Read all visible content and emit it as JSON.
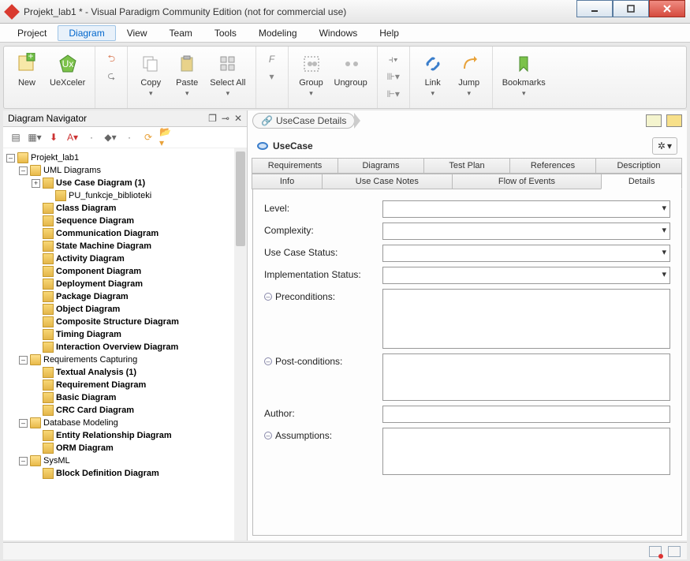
{
  "window": {
    "title": "Projekt_lab1 * - Visual Paradigm Community Edition (not for commercial use)"
  },
  "menu": {
    "items": [
      "Project",
      "Diagram",
      "View",
      "Team",
      "Tools",
      "Modeling",
      "Windows",
      "Help"
    ],
    "active": "Diagram"
  },
  "ribbon": {
    "new": "New",
    "uexceler": "UeXceler",
    "copy": "Copy",
    "paste": "Paste",
    "selectall": "Select All",
    "group": "Group",
    "ungroup": "Ungroup",
    "link": "Link",
    "jump": "Jump",
    "bookmarks": "Bookmarks"
  },
  "navigator": {
    "title": "Diagram Navigator",
    "root": "Projekt_lab1",
    "groups": [
      {
        "label": "UML Diagrams",
        "items": [
          {
            "label": "Use Case Diagram (1)",
            "bold": true,
            "children": [
              {
                "label": "PU_funkcje_biblioteki"
              }
            ]
          },
          {
            "label": "Class Diagram",
            "bold": true
          },
          {
            "label": "Sequence Diagram",
            "bold": true
          },
          {
            "label": "Communication Diagram",
            "bold": true
          },
          {
            "label": "State Machine Diagram",
            "bold": true
          },
          {
            "label": "Activity Diagram",
            "bold": true
          },
          {
            "label": "Component Diagram",
            "bold": true
          },
          {
            "label": "Deployment Diagram",
            "bold": true
          },
          {
            "label": "Package Diagram",
            "bold": true
          },
          {
            "label": "Object Diagram",
            "bold": true
          },
          {
            "label": "Composite Structure Diagram",
            "bold": true
          },
          {
            "label": "Timing Diagram",
            "bold": true
          },
          {
            "label": "Interaction Overview Diagram",
            "bold": true
          }
        ]
      },
      {
        "label": "Requirements Capturing",
        "items": [
          {
            "label": "Textual Analysis (1)",
            "bold": true
          },
          {
            "label": "Requirement Diagram",
            "bold": true
          },
          {
            "label": "Basic Diagram",
            "bold": true
          },
          {
            "label": "CRC Card Diagram",
            "bold": true
          }
        ]
      },
      {
        "label": "Database Modeling",
        "items": [
          {
            "label": "Entity Relationship Diagram",
            "bold": true
          },
          {
            "label": "ORM Diagram",
            "bold": true
          }
        ]
      },
      {
        "label": "SysML",
        "items": [
          {
            "label": "Block Definition Diagram",
            "bold": true
          }
        ]
      }
    ]
  },
  "main": {
    "breadcrumb": "UseCase Details",
    "heading": "UseCase",
    "tabsRow1": [
      "Requirements",
      "Diagrams",
      "Test Plan",
      "References",
      "Description"
    ],
    "tabsRow2": [
      "Info",
      "Use Case Notes",
      "Flow of Events",
      "Details"
    ],
    "activeTab": "Details",
    "fields": {
      "level": "Level:",
      "complexity": "Complexity:",
      "ucstatus": "Use Case Status:",
      "implstatus": "Implementation Status:",
      "preconditions": "Preconditions:",
      "postconditions": "Post-conditions:",
      "author": "Author:",
      "assumptions": "Assumptions:"
    }
  }
}
